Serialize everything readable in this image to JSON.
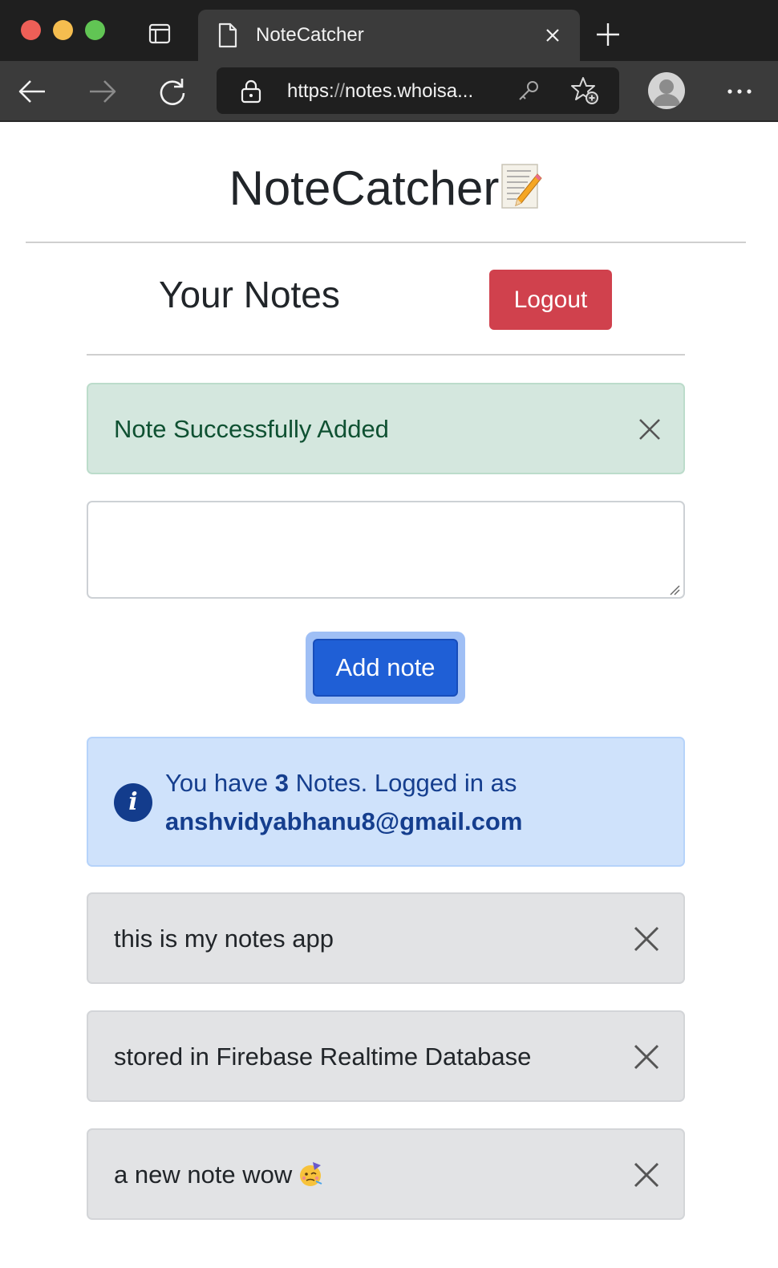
{
  "browser": {
    "tab_title": "NoteCatcher",
    "url_prefix": "https:",
    "url_slashes": "//",
    "url_rest": "notes.whoisa..."
  },
  "app": {
    "title": "NoteCatcher",
    "notes_heading": "Your Notes",
    "logout_label": "Logout",
    "success_message": "Note Successfully Added",
    "note_input_value": "",
    "add_note_label": "Add note",
    "info": {
      "prefix": "You have ",
      "count": "3",
      "suffix": " Notes. Logged in as",
      "email": "anshvidyabhanu8@gmail.com"
    },
    "notes": [
      {
        "text": "this is my notes app"
      },
      {
        "text": "stored in Firebase Realtime Database"
      },
      {
        "text": "a new note wow",
        "emoji": "partying-face-icon"
      }
    ]
  },
  "colors": {
    "logout": "#d0414d",
    "add_note": "#1f5fd6",
    "success_bg": "#d4e7de",
    "info_bg": "#cfe2fb",
    "note_bg": "#e2e3e5"
  }
}
